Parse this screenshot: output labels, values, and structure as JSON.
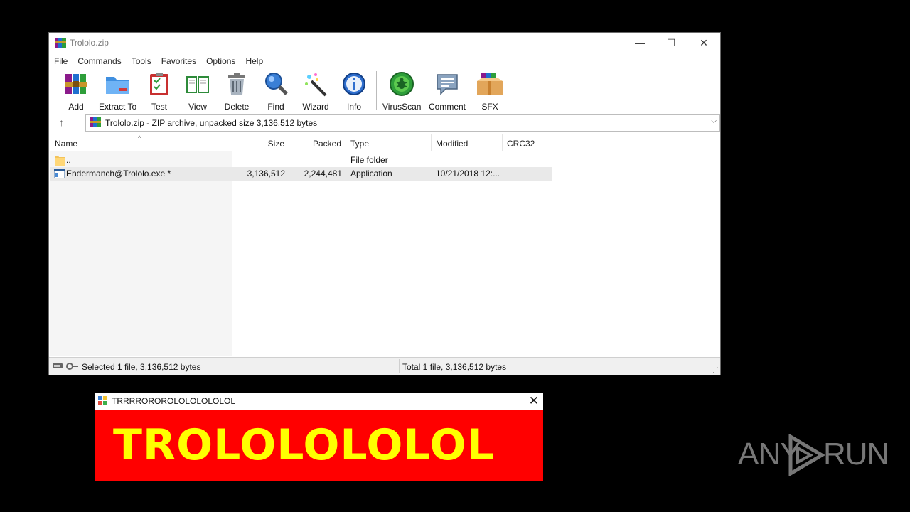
{
  "window": {
    "title": "Trololo.zip",
    "controls": {
      "minimize": "—",
      "maximize": "☐",
      "close": "✕"
    }
  },
  "menu": [
    "File",
    "Commands",
    "Tools",
    "Favorites",
    "Options",
    "Help"
  ],
  "toolbar": [
    {
      "label": "Add",
      "icon": "add-archive-icon"
    },
    {
      "label": "Extract To",
      "icon": "extract-folder-icon"
    },
    {
      "label": "Test",
      "icon": "test-clipboard-icon"
    },
    {
      "label": "View",
      "icon": "view-book-icon"
    },
    {
      "label": "Delete",
      "icon": "trash-icon"
    },
    {
      "label": "Find",
      "icon": "magnifier-icon"
    },
    {
      "label": "Wizard",
      "icon": "wand-icon"
    },
    {
      "label": "Info",
      "icon": "info-icon"
    },
    {
      "label": "VirusScan",
      "icon": "virus-scan-icon"
    },
    {
      "label": "Comment",
      "icon": "comment-icon"
    },
    {
      "label": "SFX",
      "icon": "sfx-box-icon"
    }
  ],
  "address": {
    "text": "Trololo.zip - ZIP archive, unpacked size 3,136,512 bytes"
  },
  "columns": [
    "Name",
    "Size",
    "Packed",
    "Type",
    "Modified",
    "CRC32"
  ],
  "rows": [
    {
      "name": "..",
      "size": "",
      "packed": "",
      "type": "File folder",
      "modified": "",
      "crc": "",
      "icon": "folder-icon"
    },
    {
      "name": "Endermanch@Trololo.exe *",
      "size": "3,136,512",
      "packed": "2,244,481",
      "type": "Application",
      "modified": "10/21/2018 12:...",
      "crc": "",
      "icon": "exe-icon"
    }
  ],
  "status": {
    "left": "Selected 1 file, 3,136,512 bytes",
    "right": "Total 1 file, 3,136,512 bytes"
  },
  "dialog": {
    "title": "TRRRROROROLOLOLOLOLOL",
    "message": "TROLOLOLOLOL",
    "close": "✕"
  },
  "watermark": {
    "left": "ANY",
    "right": "RUN"
  },
  "colors": {
    "dialog_bg": "#ff0000",
    "dialog_text": "#ffff00"
  }
}
